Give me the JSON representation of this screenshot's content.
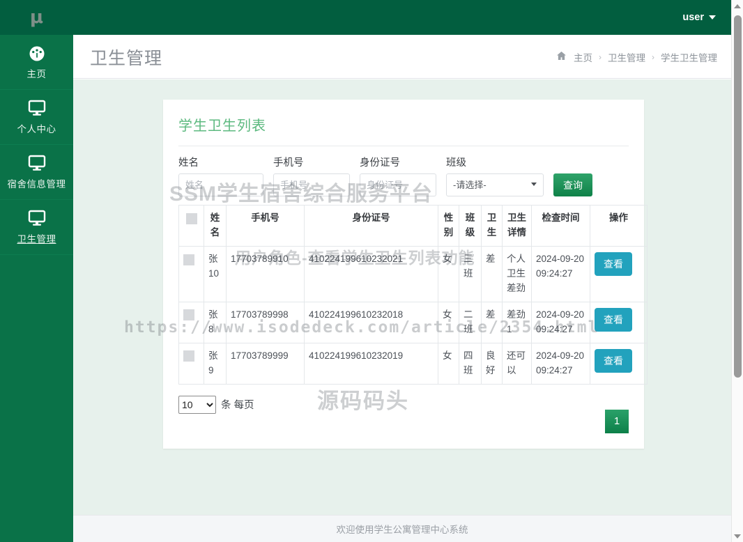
{
  "brand": {
    "logo_glyph": "μ"
  },
  "topbar": {
    "user_label": "user"
  },
  "sidebar": {
    "items": [
      {
        "label": "主页",
        "icon": "dashboard-icon",
        "active": false
      },
      {
        "label": "个人中心",
        "icon": "monitor-icon",
        "active": false
      },
      {
        "label": "宿舍信息管理",
        "icon": "monitor-icon",
        "active": false
      },
      {
        "label": "卫生管理",
        "icon": "monitor-icon",
        "active": true
      }
    ]
  },
  "header": {
    "page_title": "卫生管理",
    "breadcrumb": [
      {
        "label": "主页",
        "current": false
      },
      {
        "label": "卫生管理",
        "current": false
      },
      {
        "label": "学生卫生管理",
        "current": true
      }
    ],
    "breadcrumb_sep": "›"
  },
  "card": {
    "title": "学生卫生列表"
  },
  "search": {
    "name_label": "姓名",
    "name_placeholder": "姓名",
    "name_value": "",
    "phone_label": "手机号",
    "phone_placeholder": "手机号",
    "phone_value": "",
    "idcard_label": "身份证号",
    "idcard_placeholder": "身份证号",
    "idcard_value": "",
    "class_label": "班级",
    "class_selected": "-请选择-",
    "submit_label": "查询"
  },
  "table": {
    "columns": [
      "",
      "姓名",
      "手机号",
      "身份证号",
      "性别",
      "班级",
      "卫生",
      "卫生详情",
      "检查时间",
      "操作"
    ],
    "action_label": "查看",
    "rows": [
      {
        "name": "张10",
        "phone": "17703789910",
        "idcard": "410224199610232021",
        "sex": "女",
        "class": "三班",
        "hygiene": "差",
        "detail": "个人卫生差劲",
        "time": "2024-09-20 09:24:27"
      },
      {
        "name": "张8",
        "phone": "17703789998",
        "idcard": "410224199610232018",
        "sex": "女",
        "class": "二班",
        "hygiene": "差",
        "detail": "差劲1",
        "time": "2024-09-20 09:24:27"
      },
      {
        "name": "张9",
        "phone": "17703789999",
        "idcard": "410224199610232019",
        "sex": "女",
        "class": "四班",
        "hygiene": "良好",
        "detail": "还可以",
        "time": "2024-09-20 09:24:27"
      }
    ]
  },
  "pagination": {
    "per_page_value": "10",
    "per_page_suffix": "条 每页",
    "current_page": "1"
  },
  "footer": {
    "text": "欢迎使用学生公寓管理中心系统"
  },
  "watermarks": {
    "line1": "SSM学生宿舍综合服务平台",
    "line2": "用户角色-查看学生卫生列表功能",
    "line3": "https://www.isodedeck.com/article/2354.html",
    "line4": "源码码头"
  },
  "colors": {
    "sidebar": "#0a7248",
    "topbar": "#025e3f",
    "content_bg": "#e7f1ec",
    "accent_green": "#5cb97f",
    "view_button": "#22a2bd"
  }
}
